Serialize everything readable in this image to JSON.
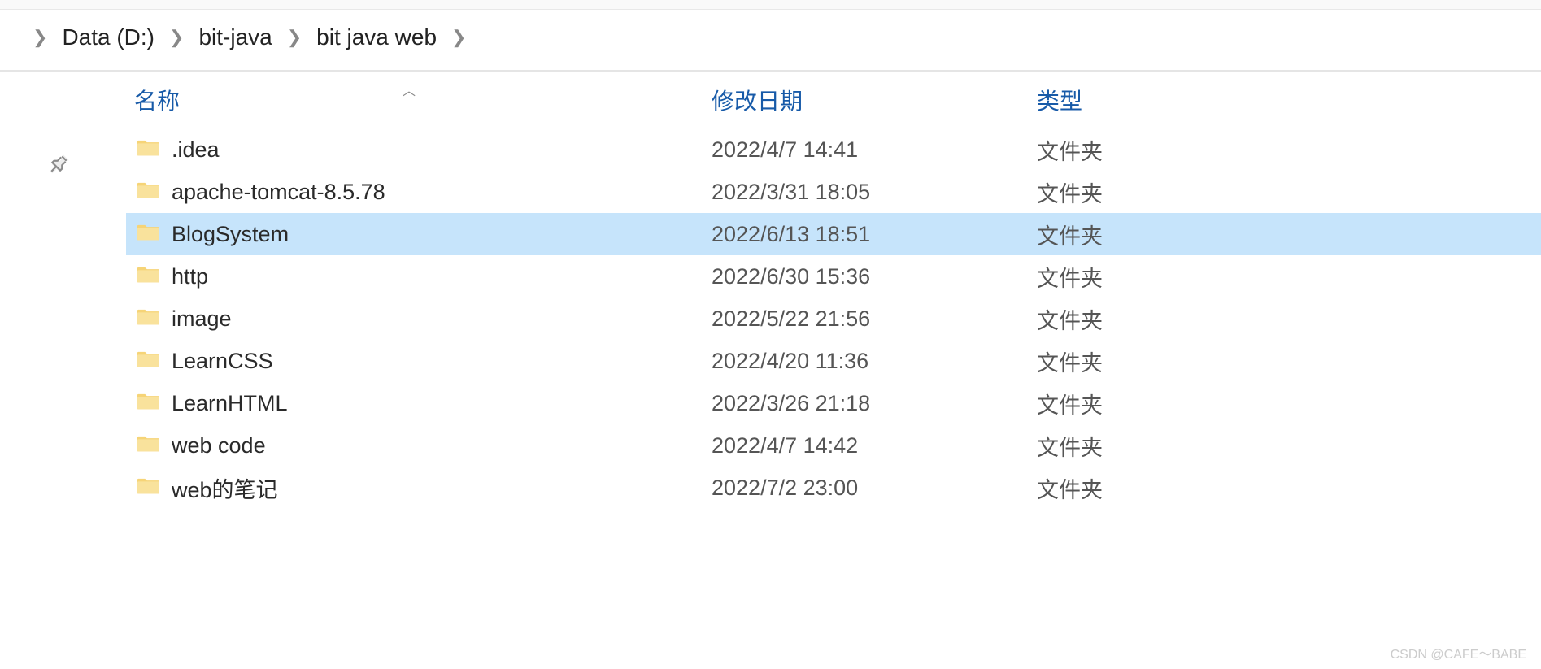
{
  "breadcrumb": {
    "items": [
      {
        "label": "Data (D:)"
      },
      {
        "label": "bit-java"
      },
      {
        "label": "bit java web"
      }
    ]
  },
  "columns": {
    "name": "名称",
    "modified": "修改日期",
    "type": "类型"
  },
  "type_labels": {
    "folder": "文件夹"
  },
  "rows": [
    {
      "name": ".idea",
      "modified": "2022/4/7 14:41",
      "type": "文件夹",
      "selected": false
    },
    {
      "name": "apache-tomcat-8.5.78",
      "modified": "2022/3/31 18:05",
      "type": "文件夹",
      "selected": false
    },
    {
      "name": "BlogSystem",
      "modified": "2022/6/13 18:51",
      "type": "文件夹",
      "selected": true
    },
    {
      "name": "http",
      "modified": "2022/6/30 15:36",
      "type": "文件夹",
      "selected": false
    },
    {
      "name": "image",
      "modified": "2022/5/22 21:56",
      "type": "文件夹",
      "selected": false
    },
    {
      "name": "LearnCSS",
      "modified": "2022/4/20 11:36",
      "type": "文件夹",
      "selected": false
    },
    {
      "name": "LearnHTML",
      "modified": "2022/3/26 21:18",
      "type": "文件夹",
      "selected": false
    },
    {
      "name": "web code",
      "modified": "2022/4/7 14:42",
      "type": "文件夹",
      "selected": false
    },
    {
      "name": "web的笔记",
      "modified": "2022/7/2 23:00",
      "type": "文件夹",
      "selected": false
    }
  ],
  "watermark": "CSDN @CAFE～BABE"
}
